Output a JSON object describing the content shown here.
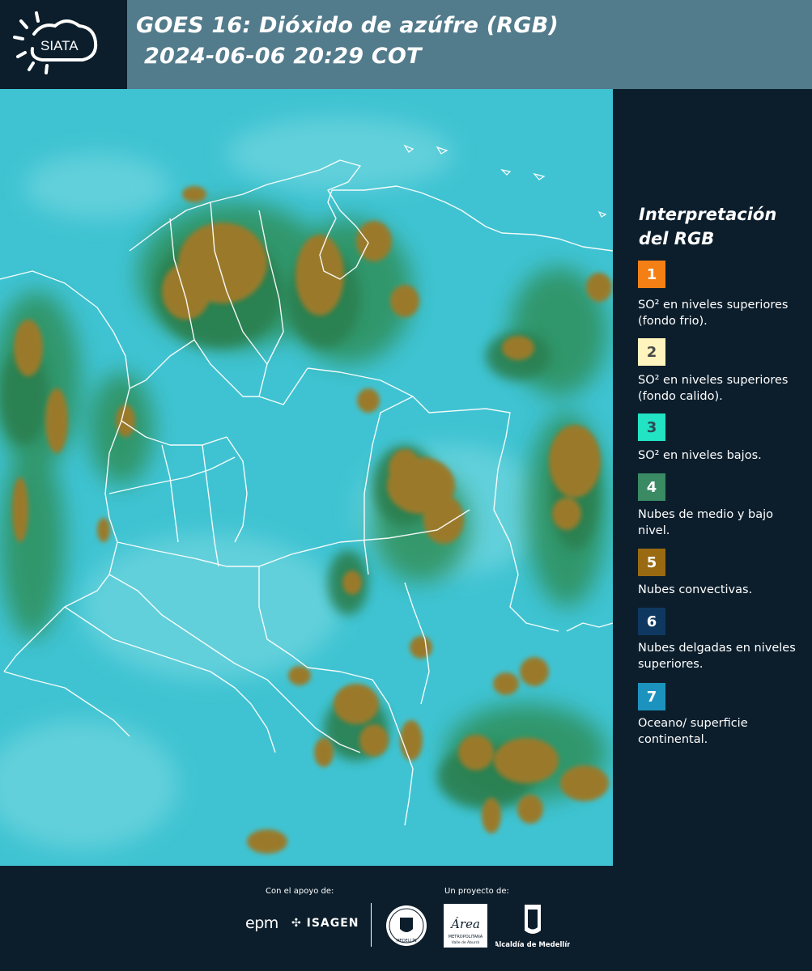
{
  "header": {
    "logo_text": "SIATA",
    "title_line1": "GOES 16: Dióxido de azúfre (RGB)",
    "title_line2": "2024-06-06 20:29 COT"
  },
  "legend": {
    "title": "Interpretación del RGB",
    "items": [
      {
        "number": "1",
        "label": "SO² en niveles superiores (fondo frio).",
        "color": "#f47f15",
        "number_color": "#ffffff"
      },
      {
        "number": "2",
        "label": "SO² en niveles superiores (fondo calido).",
        "color": "#fff4bd",
        "number_color": "#4a4a4a"
      },
      {
        "number": "3",
        "label": "SO² en niveles bajos.",
        "color": "#22e3c4",
        "number_color": "#2b4a55"
      },
      {
        "number": "4",
        "label": "Nubes de medio y bajo nivel.",
        "color": "#3a8a64",
        "number_color": "#ffffff"
      },
      {
        "number": "5",
        "label": "Nubes convectivas.",
        "color": "#9a6a12",
        "number_color": "#ffffff"
      },
      {
        "number": "6",
        "label": "Nubes delgadas en niveles superiores.",
        "color": "#0f3860",
        "number_color": "#ffffff"
      },
      {
        "number": "7",
        "label": "Oceano/ superficie continental.",
        "color": "#1c93bf",
        "number_color": "#ffffff"
      }
    ]
  },
  "footer": {
    "support_label": "Con el apoyo de:",
    "project_label": "Un proyecto de:",
    "sponsor_1": "epm",
    "sponsor_2": "ISAGEN",
    "seal_text": "MEDELLÍN",
    "partner_1_name": "Área",
    "partner_1_sub": "METROPOLITANA",
    "partner_1_sub2": "Valle de Aburrá",
    "partner_2": "Alcaldía de Medellín"
  },
  "colors": {
    "background": "#0c1e2c",
    "header_band": "#527b8b",
    "map_base": "#3fc3d2",
    "convective": "#9a7a2a",
    "vegetation": "#2f8f5a",
    "borders": "#ffffff"
  }
}
